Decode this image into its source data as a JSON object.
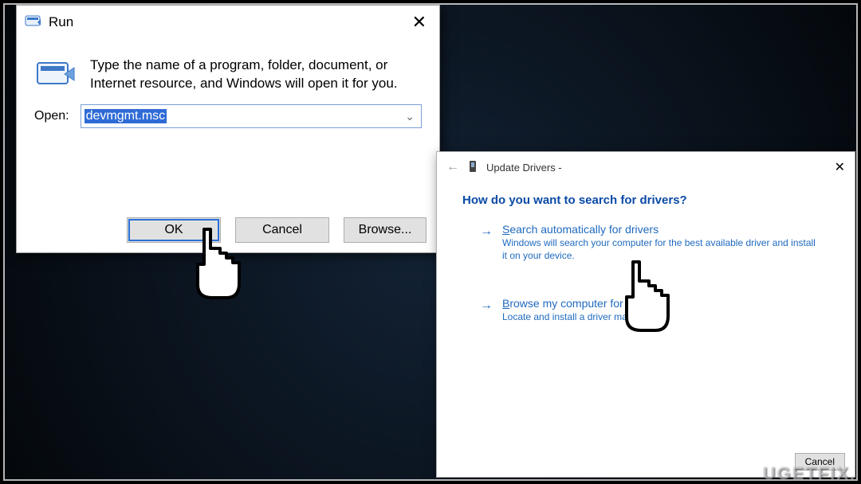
{
  "run": {
    "title": "Run",
    "help": "Type the name of a program, folder, document, or Internet resource, and Windows will open it for you.",
    "open_label": "Open:",
    "open_value": "devmgmt.msc",
    "buttons": {
      "ok": "OK",
      "cancel": "Cancel",
      "browse": "Browse..."
    },
    "close_aria": "Close"
  },
  "wizard": {
    "title": "Update Drivers -",
    "question": "How do you want to search for drivers?",
    "opt1_title": "Search automatically for drivers",
    "opt1_prefix": "S",
    "opt1_desc": "Windows will search your computer for the best available driver and install it on your device.",
    "opt2_title": "Browse my computer for drivers",
    "opt2_prefix": "B",
    "opt2_desc": "Locate and install a driver manually.",
    "cancel": "Cancel"
  },
  "watermark": "UGETFIX."
}
